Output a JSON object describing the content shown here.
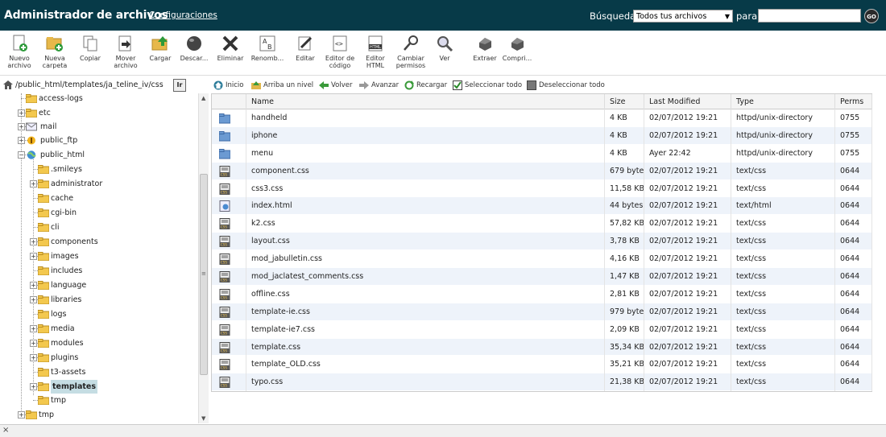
{
  "header": {
    "title": "Administrador de archivos",
    "settings_link": "Configuraciones",
    "search_label": "Búsqueda",
    "search_scope": "Todos tus archivos",
    "para_label": "para",
    "search_value": "",
    "go_label": "GO"
  },
  "toolbar": {
    "items": [
      {
        "label1": "Nuevo",
        "label2": "archivo",
        "icon": "new-file-icon"
      },
      {
        "label1": "Nueva",
        "label2": "carpeta",
        "icon": "new-folder-icon"
      },
      {
        "label1": "Copiar",
        "label2": "",
        "icon": "copy-icon"
      },
      {
        "label1": "Mover",
        "label2": "archivo",
        "icon": "move-icon"
      },
      {
        "label1": "Cargar",
        "label2": "",
        "icon": "upload-icon"
      },
      {
        "label1": "Descar...",
        "label2": "",
        "icon": "download-icon"
      },
      {
        "label1": "Eliminar",
        "label2": "",
        "icon": "delete-icon"
      },
      {
        "label1": "Renomb...",
        "label2": "",
        "icon": "rename-icon"
      },
      {
        "label1": "Editar",
        "label2": "",
        "icon": "edit-icon"
      },
      {
        "label1": "Editor de",
        "label2": "código",
        "icon": "code-editor-icon"
      },
      {
        "label1": "Editor",
        "label2": "HTML",
        "icon": "html-editor-icon"
      },
      {
        "label1": "Cambiar",
        "label2": "permisos",
        "icon": "permissions-icon"
      },
      {
        "label1": "Ver",
        "label2": "",
        "icon": "view-icon"
      },
      {
        "label1": "Extraer",
        "label2": "",
        "icon": "extract-icon"
      },
      {
        "label1": "Compri...",
        "label2": "",
        "icon": "compress-icon"
      }
    ]
  },
  "path": {
    "value": "/public_html/templates/ja_teline_iv/css",
    "go_label": "Ir"
  },
  "tree": {
    "items": [
      {
        "label": "access-logs"
      },
      {
        "label": "etc"
      },
      {
        "label": "mail"
      },
      {
        "label": "public_ftp"
      },
      {
        "label": "public_html"
      },
      {
        "label": ".smileys"
      },
      {
        "label": "administrator"
      },
      {
        "label": "cache"
      },
      {
        "label": "cgi-bin"
      },
      {
        "label": "cli"
      },
      {
        "label": "components"
      },
      {
        "label": "images"
      },
      {
        "label": "includes"
      },
      {
        "label": "language"
      },
      {
        "label": "libraries"
      },
      {
        "label": "logs"
      },
      {
        "label": "media"
      },
      {
        "label": "modules"
      },
      {
        "label": "plugins"
      },
      {
        "label": "t3-assets"
      },
      {
        "label": "templates"
      },
      {
        "label": "tmp"
      },
      {
        "label": "tmp"
      }
    ]
  },
  "nav": {
    "home": "Inicio",
    "up": "Arriba un nivel",
    "back": "Volver",
    "forward": "Avanzar",
    "reload": "Recargar",
    "select_all": "Seleccionar todo",
    "deselect_all": "Deseleccionar todo"
  },
  "table": {
    "columns": [
      "Name",
      "Size",
      "Last Modified",
      "Type",
      "Perms"
    ],
    "rows": [
      {
        "name": "handheld",
        "size": "4 KB",
        "modified": "02/07/2012 19:21",
        "type": "httpd/unix-directory",
        "perms": "0755",
        "kind": "folder"
      },
      {
        "name": "iphone",
        "size": "4 KB",
        "modified": "02/07/2012 19:21",
        "type": "httpd/unix-directory",
        "perms": "0755",
        "kind": "folder"
      },
      {
        "name": "menu",
        "size": "4 KB",
        "modified": "Ayer 22:42",
        "type": "httpd/unix-directory",
        "perms": "0755",
        "kind": "folder"
      },
      {
        "name": "component.css",
        "size": "679 bytes",
        "modified": "02/07/2012 19:21",
        "type": "text/css",
        "perms": "0644",
        "kind": "css"
      },
      {
        "name": "css3.css",
        "size": "11,58 KB",
        "modified": "02/07/2012 19:21",
        "type": "text/css",
        "perms": "0644",
        "kind": "css"
      },
      {
        "name": "index.html",
        "size": "44 bytes",
        "modified": "02/07/2012 19:21",
        "type": "text/html",
        "perms": "0644",
        "kind": "html"
      },
      {
        "name": "k2.css",
        "size": "57,82 KB",
        "modified": "02/07/2012 19:21",
        "type": "text/css",
        "perms": "0644",
        "kind": "css"
      },
      {
        "name": "layout.css",
        "size": "3,78 KB",
        "modified": "02/07/2012 19:21",
        "type": "text/css",
        "perms": "0644",
        "kind": "css"
      },
      {
        "name": "mod_jabulletin.css",
        "size": "4,16 KB",
        "modified": "02/07/2012 19:21",
        "type": "text/css",
        "perms": "0644",
        "kind": "css"
      },
      {
        "name": "mod_jaclatest_comments.css",
        "size": "1,47 KB",
        "modified": "02/07/2012 19:21",
        "type": "text/css",
        "perms": "0644",
        "kind": "css"
      },
      {
        "name": "offline.css",
        "size": "2,81 KB",
        "modified": "02/07/2012 19:21",
        "type": "text/css",
        "perms": "0644",
        "kind": "css"
      },
      {
        "name": "template-ie.css",
        "size": "979 bytes",
        "modified": "02/07/2012 19:21",
        "type": "text/css",
        "perms": "0644",
        "kind": "css"
      },
      {
        "name": "template-ie7.css",
        "size": "2,09 KB",
        "modified": "02/07/2012 19:21",
        "type": "text/css",
        "perms": "0644",
        "kind": "css"
      },
      {
        "name": "template.css",
        "size": "35,34 KB",
        "modified": "02/07/2012 19:21",
        "type": "text/css",
        "perms": "0644",
        "kind": "css"
      },
      {
        "name": "template_OLD.css",
        "size": "35,21 KB",
        "modified": "02/07/2012 19:21",
        "type": "text/css",
        "perms": "0644",
        "kind": "css"
      },
      {
        "name": "typo.css",
        "size": "21,38 KB",
        "modified": "02/07/2012 19:21",
        "type": "text/css",
        "perms": "0644",
        "kind": "css"
      }
    ]
  },
  "status": {
    "close_glyph": "×"
  },
  "colors": {
    "header_bg": "#073a48",
    "row_alt": "#eef3fa",
    "selected": "#c5dde3"
  }
}
